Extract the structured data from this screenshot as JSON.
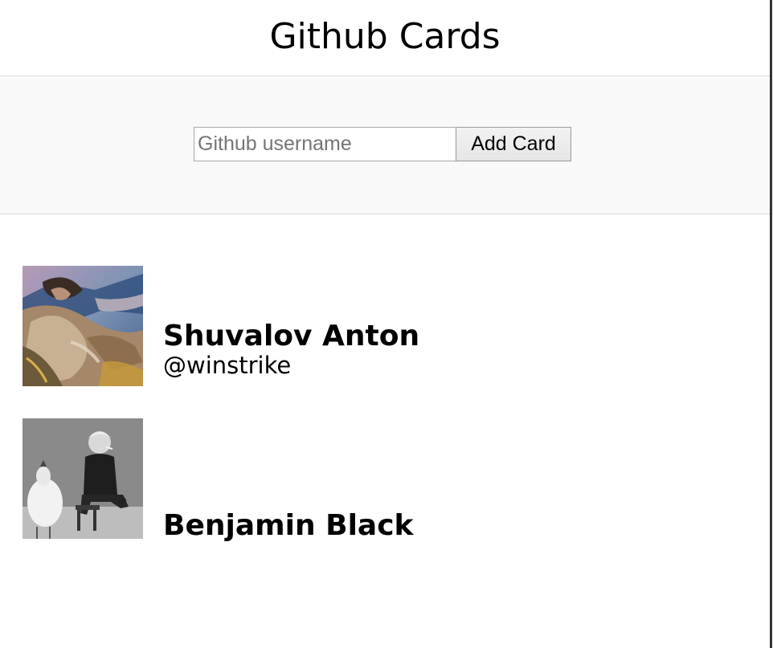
{
  "header": {
    "title": "Github Cards"
  },
  "form": {
    "username_placeholder": "Github username",
    "username_value": "",
    "add_button_label": "Add Card"
  },
  "cards": [
    {
      "name": "Shuvalov Anton",
      "login": "@winstrike",
      "avatar_icon": "painting-avatar-icon"
    },
    {
      "name": "Benjamin Black",
      "login": "",
      "avatar_icon": "photo-avatar-icon"
    }
  ],
  "colors": {
    "page_background": "#ffffff",
    "form_band_background": "#f9f9f9",
    "divider": "#dddddd",
    "right_border": "#333333"
  }
}
